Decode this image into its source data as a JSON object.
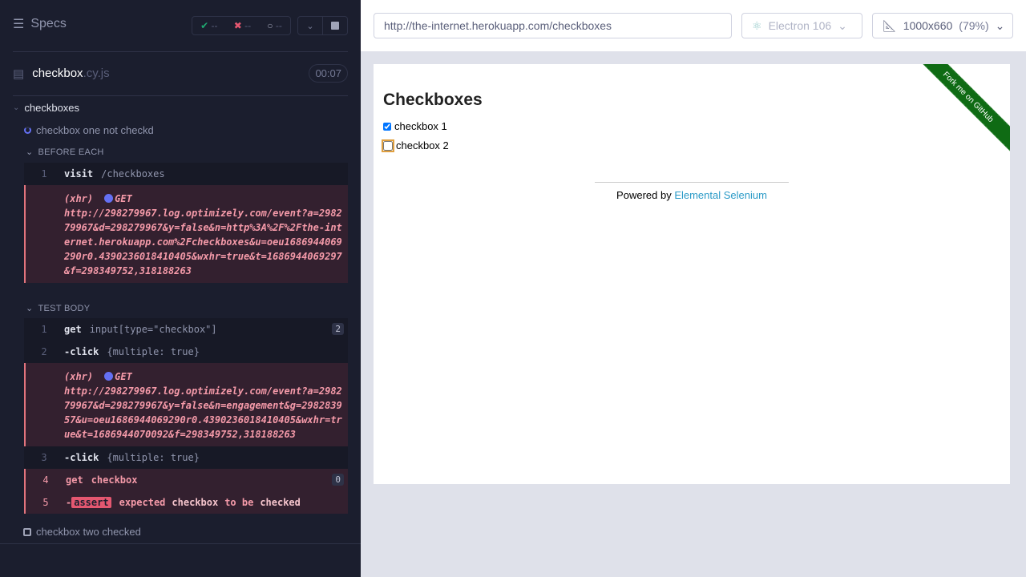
{
  "reporter": {
    "title": "Specs",
    "passed": "--",
    "failed": "--",
    "pending": "--",
    "spec_name": "checkbox",
    "spec_ext": ".cy.js",
    "duration": "00:07",
    "suite": "checkboxes",
    "tests": [
      {
        "title": "checkbox one not checkd",
        "state": "running"
      },
      {
        "title": "checkbox two checked",
        "state": "pending"
      }
    ],
    "before_each": {
      "label": "BEFORE EACH",
      "commands": [
        {
          "num": "1",
          "name": "visit",
          "arg": "/checkboxes"
        }
      ],
      "xhr": {
        "type": "(xhr)",
        "method": "GET",
        "url": "http://298279967.log.optimizely.com/event?a=298279967&d=298279967&y=false&n=http%3A%2F%2Fthe-internet.herokuapp.com%2Fcheckboxes&u=oeu1686944069290r0.4390236018410405&wxhr=true&t=1686944069297&f=298349752,318188263"
      }
    },
    "test_body": {
      "label": "TEST BODY",
      "commands": [
        {
          "num": "1",
          "name": "get",
          "arg": "input[type=\"checkbox\"]",
          "count": "2"
        },
        {
          "num": "2",
          "name": "-click",
          "arg": "{multiple: true}"
        },
        {
          "num": "3",
          "name": "-click",
          "arg": "{multiple: true}"
        },
        {
          "num": "4",
          "name": "get",
          "arg": "checkbox",
          "count": "0"
        },
        {
          "num": "5",
          "name": "-",
          "assert": "assert",
          "msg": [
            "expected",
            "checkbox",
            "to be",
            "checked"
          ]
        }
      ],
      "xhr": {
        "type": "(xhr)",
        "method": "GET",
        "url": "http://298279967.log.optimizely.com/event?a=298279967&d=298279967&y=false&n=engagement&g=298283957&u=oeu1686944069290r0.4390236018410405&wxhr=true&t=1686944070092&f=298349752,318188263"
      }
    }
  },
  "toolbar": {
    "url": "http://the-internet.herokuapp.com/checkboxes",
    "browser": "Electron 106",
    "viewport": "1000x660",
    "zoom": "(79%)"
  },
  "aut": {
    "heading": "Checkboxes",
    "checkboxes": [
      {
        "label": "checkbox 1",
        "checked": true
      },
      {
        "label": "checkbox 2",
        "checked": false
      }
    ],
    "powered_by": "Powered by ",
    "link": "Elemental Selenium",
    "ribbon": "Fork me on GitHub"
  },
  "colors": {
    "sidebar_bg": "#1b1e2e",
    "fail": "#e45770",
    "ribbon": "#0f6b14",
    "link": "#2a9ac7"
  }
}
